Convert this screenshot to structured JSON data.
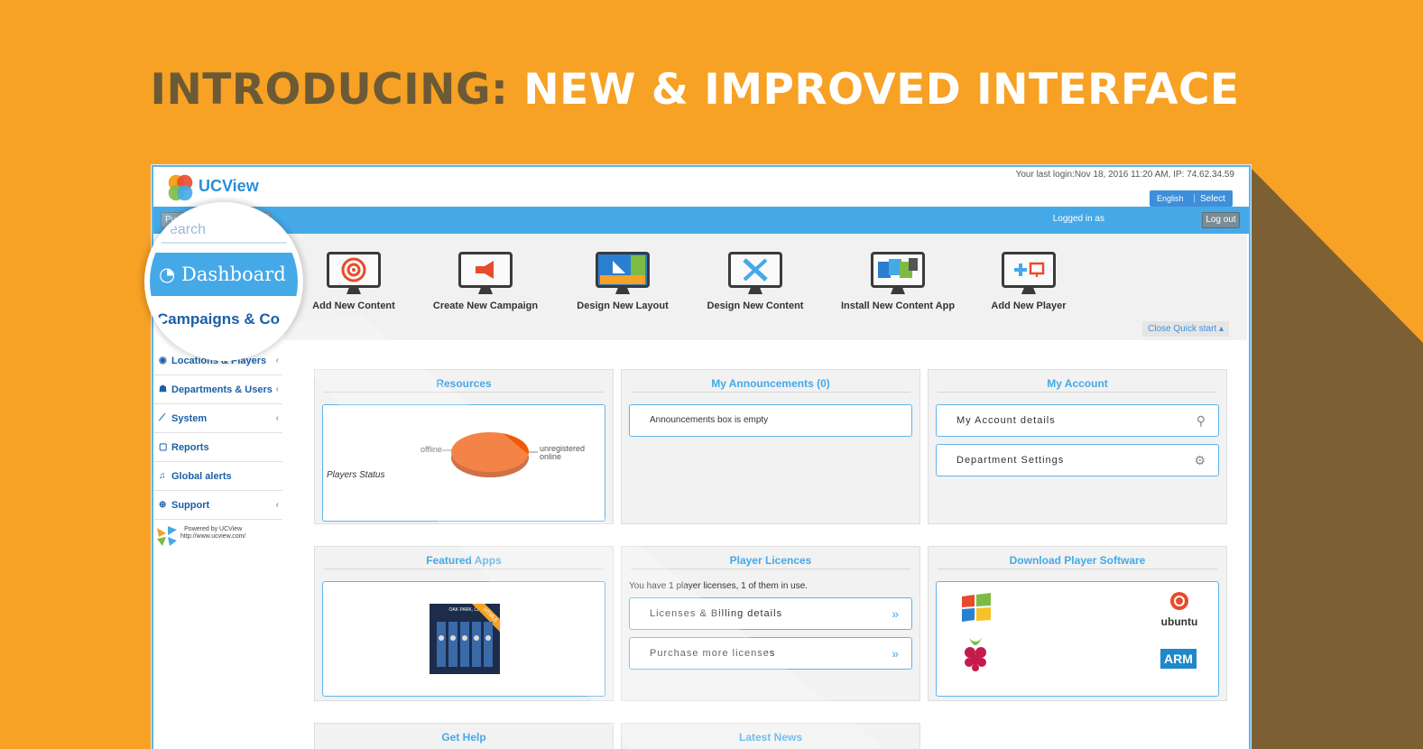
{
  "headline": {
    "part1": "INTRODUCING:",
    "part2": "NEW & IMPROVED INTERFACE"
  },
  "app": {
    "logo_text": "UCView",
    "last_login": "Your last login:Nov 18, 2016 11:20 AM, IP: 74.62.34.59",
    "language": "English",
    "language_select_label": "Select",
    "logged_in_label": "Logged in as",
    "logout_label": "Log out",
    "pill_text": "Pu"
  },
  "quick_start": {
    "items": [
      {
        "label": "Add New Content",
        "icon": "target-icon"
      },
      {
        "label": "Create New Campaign",
        "icon": "megaphone-icon"
      },
      {
        "label": "Design New Layout",
        "icon": "layout-icon"
      },
      {
        "label": "Design New Content",
        "icon": "design-tools-icon"
      },
      {
        "label": "Install New Content App",
        "icon": "apps-icon"
      },
      {
        "label": "Add New Player",
        "icon": "add-player-icon"
      }
    ],
    "close_label": "Close Quick start ▴"
  },
  "magnifier": {
    "search_placeholder": "earch",
    "dashboard_label": "Dashboard",
    "campaigns_label": "Campaigns & Co"
  },
  "sidebar": {
    "items": [
      {
        "label": "Locations & Players",
        "icon": "location-icon",
        "chevron": "‹"
      },
      {
        "label": "Departments & Users",
        "icon": "users-icon",
        "chevron": "‹"
      },
      {
        "label": "System",
        "icon": "chart-icon",
        "chevron": "‹"
      },
      {
        "label": "Reports",
        "icon": "reports-icon",
        "chevron": ""
      },
      {
        "label": "Global alerts",
        "icon": "bell-icon",
        "chevron": ""
      },
      {
        "label": "Support",
        "icon": "support-icon",
        "chevron": "‹"
      }
    ],
    "powered_line1": "Powered by UCView",
    "powered_line2": "http://www.ucview.com/"
  },
  "panels": {
    "resources": {
      "title": "Resources",
      "chart_caption": "Players Status",
      "label_offline": "offline",
      "label_unregistered": "unregistered",
      "label_online": "online"
    },
    "announcements": {
      "title": "My Announcements (0)",
      "empty_text": "Announcements box is empty"
    },
    "account": {
      "title": "My Account",
      "details_label": "My Account details",
      "settings_label": "Department Settings"
    },
    "featured": {
      "title": "Featured Apps",
      "app_tile_text": "OAK PARK, CA",
      "app_badge": "HTML5"
    },
    "licences": {
      "title": "Player Licences",
      "summary": "You have 1 player licenses,  1 of them in use.",
      "billing_label": "Licenses & Billing details",
      "purchase_label": "Purchase more licenses",
      "arrow": "»"
    },
    "download": {
      "title": "Download Player Software",
      "ubuntu_label": "ubuntu",
      "arm_label": "ARM"
    },
    "help": {
      "title": "Get Help"
    },
    "news": {
      "title": "Latest News"
    }
  },
  "colors": {
    "background": "#f7a125",
    "accent_blue": "#45a9e8",
    "headline_dark": "#6b5a35",
    "pie_orange": "#f05a0a"
  }
}
